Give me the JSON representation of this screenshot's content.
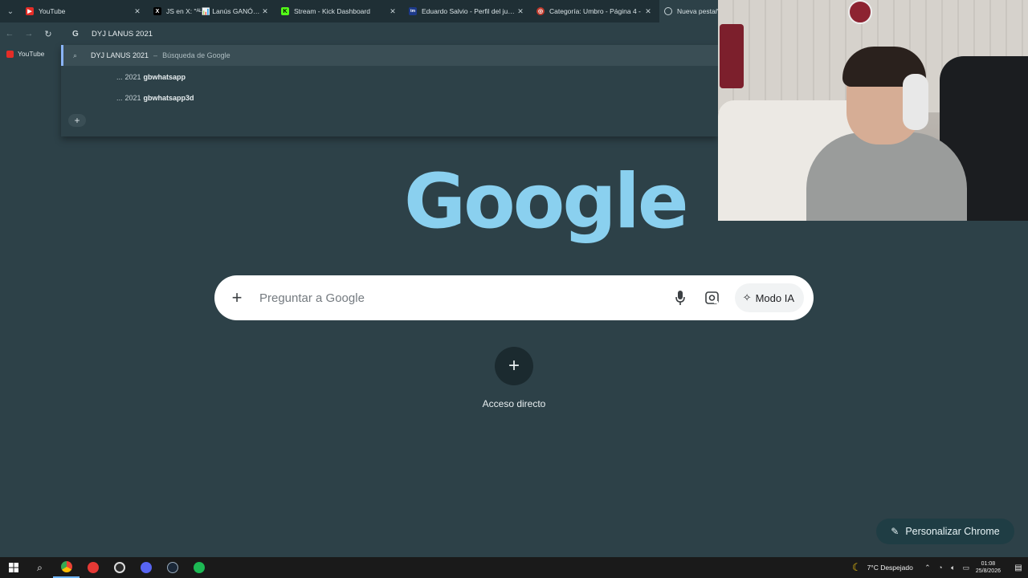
{
  "tabs": [
    {
      "title": "YouTube",
      "fav_color": "#e52d27",
      "fav_glyph": "▶"
    },
    {
      "title": "JS en X: \"ᴬᴸ📊 Lanús GANÓ SO",
      "fav_color": "#000000",
      "fav_glyph": "X"
    },
    {
      "title": "Stream - Kick Dashboard",
      "fav_color": "#53fc18",
      "fav_glyph": "K"
    },
    {
      "title": "Eduardo Salvio - Perfil del jugador",
      "fav_color": "#1d3a8a",
      "fav_glyph": "tm"
    },
    {
      "title": "Categoría: Umbro - Página 4 -",
      "fav_color": "#c0392b",
      "fav_glyph": "◎"
    },
    {
      "title": "Nueva pestaña",
      "fav_color": "#2d4148",
      "fav_glyph": "◉"
    }
  ],
  "omnibox": {
    "text": "DYJ LANUS 2021",
    "icon": "G"
  },
  "bookmarks": {
    "youtube": "YouTube"
  },
  "suggestions": {
    "main_query": "DYJ LANUS 2021",
    "main_separator": "–",
    "main_source": "Búsqueda de Google",
    "items": [
      {
        "prefix": "...",
        "year": "2021",
        "term": "gbwhatsapp"
      },
      {
        "prefix": "...",
        "year": "2021",
        "term": "gbwhatsapp3d"
      }
    ]
  },
  "google": {
    "logo": "Google"
  },
  "search": {
    "placeholder": "Preguntar a Google",
    "ai_mode": "Modo IA"
  },
  "shortcut": {
    "label": "Acceso directo"
  },
  "customize": {
    "label": "Personalizar Chrome"
  },
  "tray": {
    "weather": "7°C Despejado",
    "time": "01:08",
    "date": "25/8/2026"
  }
}
